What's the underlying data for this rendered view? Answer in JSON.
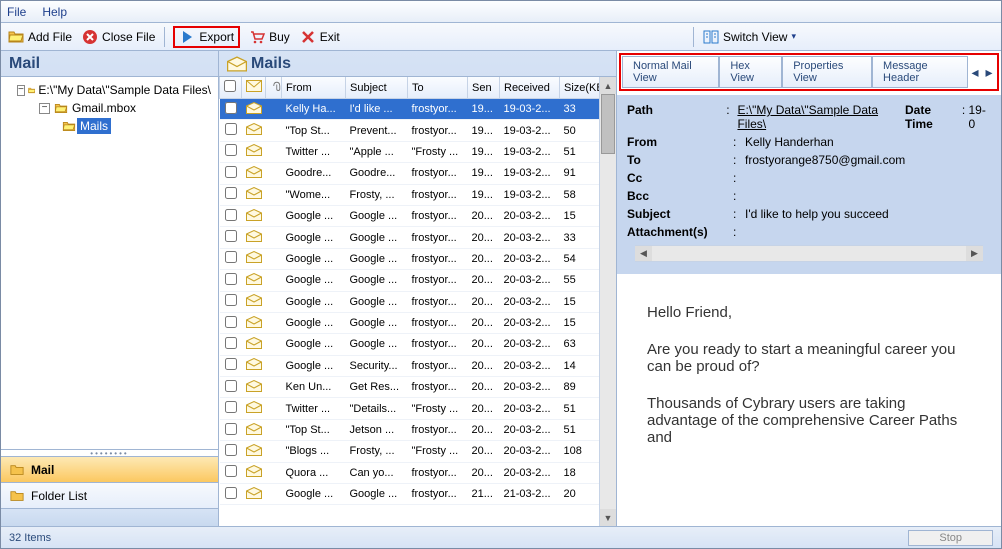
{
  "menu": {
    "file": "File",
    "help": "Help"
  },
  "toolbar": {
    "add_file": "Add File",
    "close_file": "Close File",
    "export": "Export",
    "buy": "Buy",
    "exit": "Exit",
    "switch_view": "Switch View"
  },
  "left": {
    "title": "Mail",
    "tree": {
      "root": "E:\\\"My Data\\\"Sample Data Files\\",
      "file": "Gmail.mbox",
      "folder": "Mails"
    },
    "nav": {
      "mail": "Mail",
      "folder_list": "Folder List"
    }
  },
  "middle": {
    "title": "Mails",
    "columns": {
      "from": "From",
      "subject": "Subject",
      "to": "To",
      "sent": "Sen",
      "received": "Received",
      "size": "Size(KB)"
    },
    "rows": [
      {
        "from": "Kelly Ha...",
        "subject": "I'd like ...",
        "to": "frostyor...",
        "sent": "19...",
        "received": "19-03-2...",
        "size": "33",
        "selected": true
      },
      {
        "from": "\"Top St...",
        "subject": "Prevent...",
        "to": "frostyor...",
        "sent": "19...",
        "received": "19-03-2...",
        "size": "50"
      },
      {
        "from": "Twitter ...",
        "subject": "\"Apple ...",
        "to": "\"Frosty ...",
        "sent": "19...",
        "received": "19-03-2...",
        "size": "51"
      },
      {
        "from": "Goodre...",
        "subject": "Goodre...",
        "to": "frostyor...",
        "sent": "19...",
        "received": "19-03-2...",
        "size": "91"
      },
      {
        "from": "\"Wome...",
        "subject": "Frosty, ...",
        "to": "frostyor...",
        "sent": "19...",
        "received": "19-03-2...",
        "size": "58"
      },
      {
        "from": "Google ...",
        "subject": "Google ...",
        "to": "frostyor...",
        "sent": "20...",
        "received": "20-03-2...",
        "size": "15"
      },
      {
        "from": "Google ...",
        "subject": "Google ...",
        "to": "frostyor...",
        "sent": "20...",
        "received": "20-03-2...",
        "size": "33"
      },
      {
        "from": "Google ...",
        "subject": "Google ...",
        "to": "frostyor...",
        "sent": "20...",
        "received": "20-03-2...",
        "size": "54"
      },
      {
        "from": "Google ...",
        "subject": "Google ...",
        "to": "frostyor...",
        "sent": "20...",
        "received": "20-03-2...",
        "size": "55"
      },
      {
        "from": "Google ...",
        "subject": "Google ...",
        "to": "frostyor...",
        "sent": "20...",
        "received": "20-03-2...",
        "size": "15"
      },
      {
        "from": "Google ...",
        "subject": "Google ...",
        "to": "frostyor...",
        "sent": "20...",
        "received": "20-03-2...",
        "size": "15"
      },
      {
        "from": "Google ...",
        "subject": "Google ...",
        "to": "frostyor...",
        "sent": "20...",
        "received": "20-03-2...",
        "size": "63"
      },
      {
        "from": "Google ...",
        "subject": "Security...",
        "to": "frostyor...",
        "sent": "20...",
        "received": "20-03-2...",
        "size": "14"
      },
      {
        "from": "Ken Un...",
        "subject": "Get Res...",
        "to": "frostyor...",
        "sent": "20...",
        "received": "20-03-2...",
        "size": "89"
      },
      {
        "from": "Twitter ...",
        "subject": "\"Details...",
        "to": "\"Frosty ...",
        "sent": "20...",
        "received": "20-03-2...",
        "size": "51"
      },
      {
        "from": "\"Top St...",
        "subject": "Jetson ...",
        "to": "frostyor...",
        "sent": "20...",
        "received": "20-03-2...",
        "size": "51"
      },
      {
        "from": "\"Blogs ...",
        "subject": "Frosty, ...",
        "to": "\"Frosty ...",
        "sent": "20...",
        "received": "20-03-2...",
        "size": "108"
      },
      {
        "from": "Quora ...",
        "subject": "Can yo...",
        "to": "frostyor...",
        "sent": "20...",
        "received": "20-03-2...",
        "size": "18"
      },
      {
        "from": "Google ...",
        "subject": "Google ...",
        "to": "frostyor...",
        "sent": "21...",
        "received": "21-03-2...",
        "size": "20"
      }
    ]
  },
  "right": {
    "tabs": {
      "normal": "Normal Mail View",
      "hex": "Hex View",
      "properties": "Properties View",
      "header": "Message Header"
    },
    "fields": {
      "path_label": "Path",
      "path": "E:\\\"My Data\\\"Sample Data Files\\",
      "datetime_label": "Date Time",
      "datetime": "19-0",
      "from_label": "From",
      "from": "Kelly Handerhan",
      "to_label": "To",
      "to": "frostyorange8750@gmail.com",
      "cc_label": "Cc",
      "cc": "",
      "bcc_label": "Bcc",
      "bcc": "",
      "subject_label": "Subject",
      "subject": "I'd like to help you succeed",
      "attach_label": "Attachment(s)",
      "attach": ""
    },
    "body": {
      "p1": "Hello Friend,",
      "p2": "Are you ready to start a meaningful career you can be proud of?",
      "p3": "Thousands of Cybrary users are taking advantage of the comprehensive Career Paths and"
    }
  },
  "statusbar": {
    "count": "32 Items",
    "stop": "Stop"
  }
}
